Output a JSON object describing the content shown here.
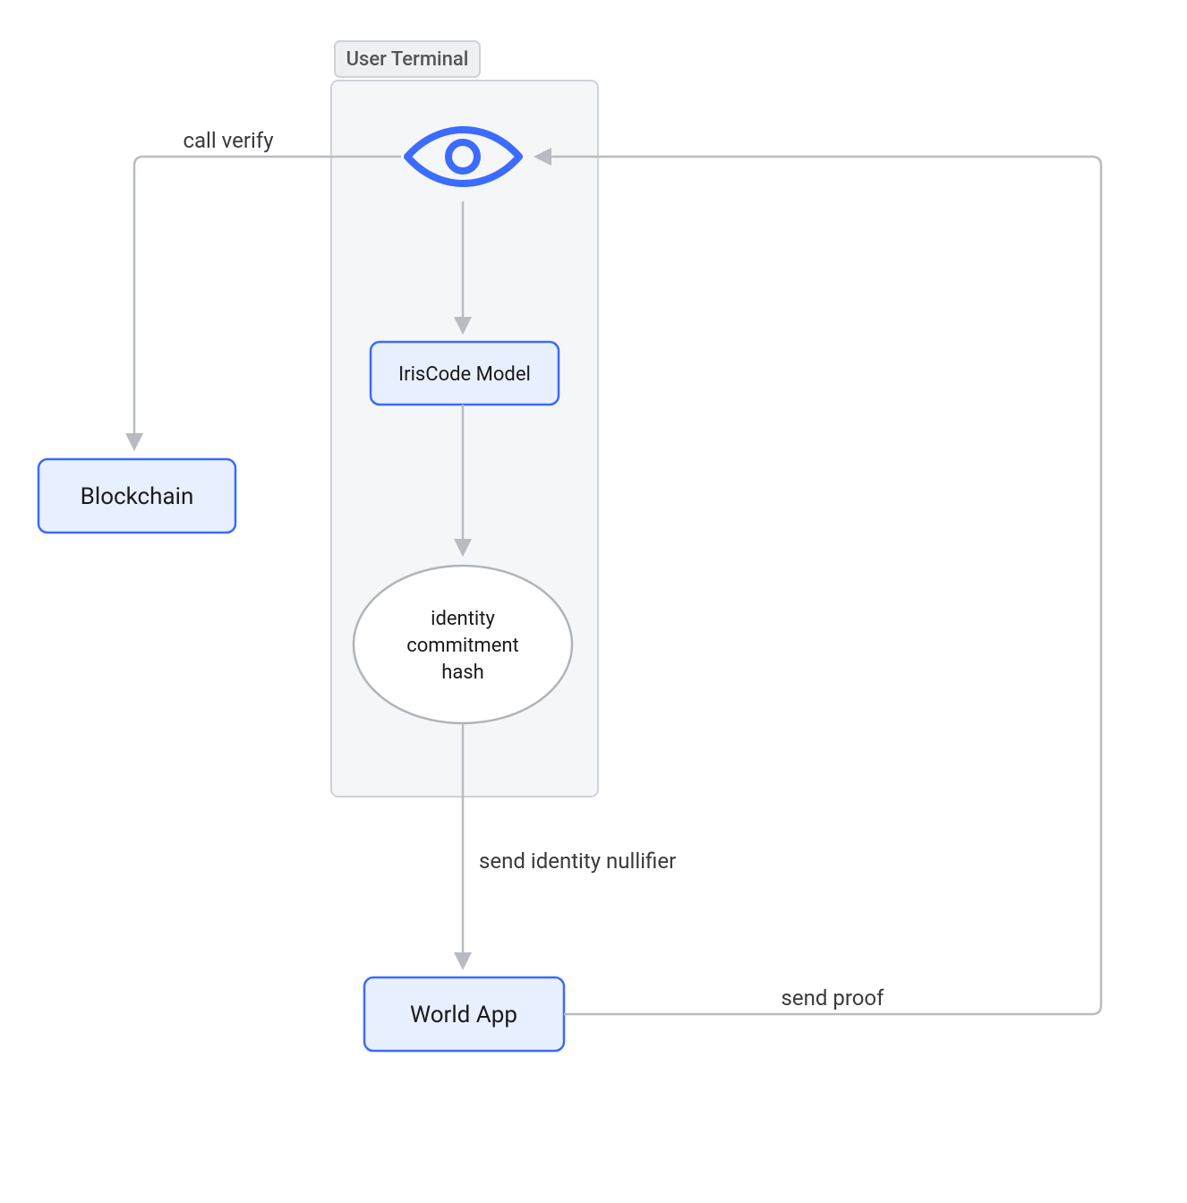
{
  "group": {
    "title": "User Terminal"
  },
  "nodes": {
    "iriscode": "IrisCode Model",
    "identity_line1": "identity",
    "identity_line2": "commitment",
    "identity_line3": "hash",
    "blockchain": "Blockchain",
    "worldapp": "World App"
  },
  "edges": {
    "call_verify": "call verify",
    "send_nullifier": "send identity nullifier",
    "send_proof": "send proof"
  },
  "colors": {
    "accent": "#3b6bff",
    "node_fill": "#e8efff",
    "group_fill": "#f5f6f8",
    "group_border": "#cfd2d8",
    "edge": "#b8bcc2",
    "ellipse_border": "#b0b4ba"
  }
}
